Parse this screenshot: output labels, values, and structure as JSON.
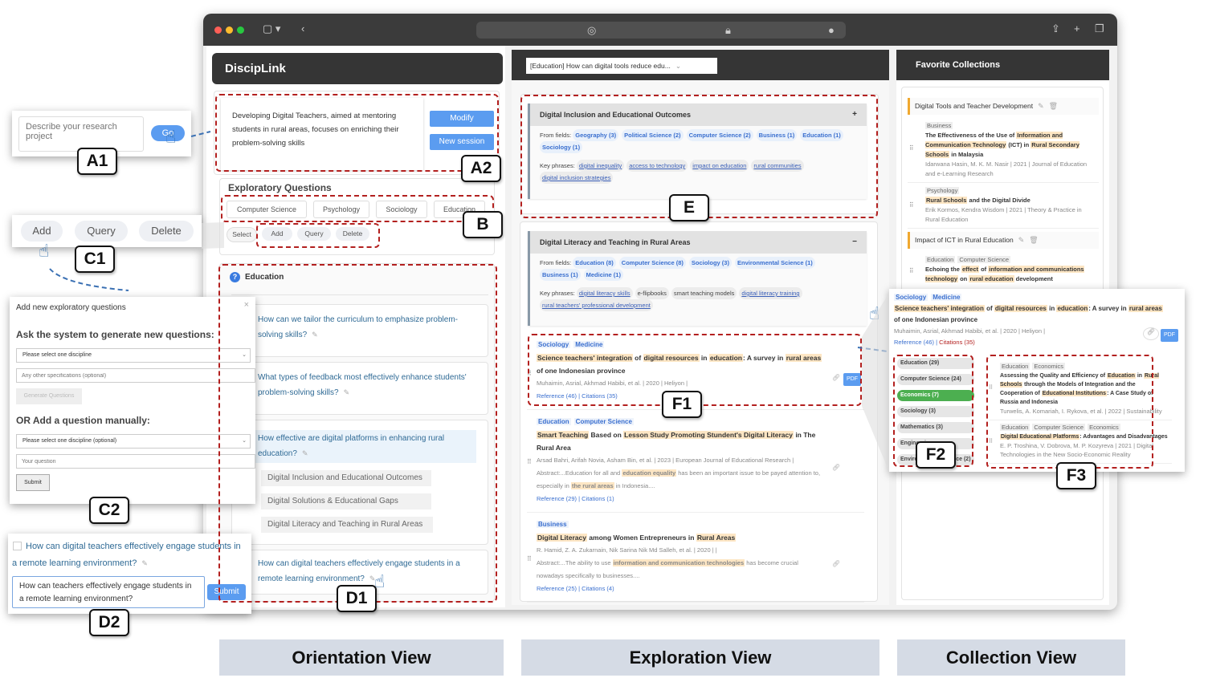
{
  "app": {
    "title": "DiscipLink"
  },
  "research": {
    "text": "Developing Digital Teachers, aimed at mentoring students in rural areas, focuses on enriching their problem-solving skills",
    "modify": "Modify",
    "new_session": "New session"
  },
  "a1": {
    "placeholder": "Describe your research project",
    "go": "Go"
  },
  "exploratory": {
    "title": "Exploratory Questions",
    "tabs": [
      "Computer Science",
      "Psychology",
      "Sociology",
      "Education"
    ],
    "actions": [
      "Select",
      "Add",
      "Query",
      "Delete"
    ]
  },
  "c1": {
    "actions": [
      "Add",
      "Query",
      "Delete"
    ]
  },
  "education": {
    "title": "Education",
    "questions": [
      "How can we tailor the curriculum to emphasize problem-solving skills?",
      "What types of feedback most effectively enhance students' problem-solving skills?",
      "How effective are digital platforms in enhancing rural education?",
      "How can digital teachers effectively engage students in a remote learning environment?"
    ],
    "subqueries": [
      "Digital Inclusion and Educational Outcomes",
      "Digital Solutions & Educational Gaps",
      "Digital Literacy and Teaching in Rural Areas"
    ]
  },
  "c2": {
    "title": "Add new exploratory questions",
    "gen_heading": "Ask the system to generate new questions:",
    "select1": "Please select one discipline",
    "spec_placeholder": "Any other specifications (optional)",
    "generate": "Generate Questions",
    "manual_heading": "OR Add a question manually:",
    "select2": "Please select one discipline (optional)",
    "question_placeholder": "Your question",
    "submit": "Submit"
  },
  "d2": {
    "question": "How can digital teachers effectively engage students in a remote learning environment?",
    "edit_value": "How can teachers effectively engage students in a remote learning environment?",
    "submit": "Submit"
  },
  "exploration": {
    "query_select": "[Education] How can digital tools reduce edu...",
    "clusters": [
      {
        "title": "Digital Inclusion and Educational Outcomes",
        "toggle": "+",
        "fields_label": "From fields:",
        "fields": [
          "Geography (3)",
          "Political Science (2)",
          "Computer Science (2)",
          "Business (1)",
          "Education (1)",
          "Sociology (1)"
        ],
        "phrases_label": "Key phrases:",
        "phrases": [
          "digital inequality",
          "access to technology",
          "impact on education",
          "rural communities",
          "digital inclusion strategies"
        ]
      },
      {
        "title": "Digital Literacy and Teaching in Rural Areas",
        "toggle": "−",
        "fields_label": "From fields:",
        "fields": [
          "Education (8)",
          "Computer Science (8)",
          "Sociology (3)",
          "Environmental Science (1)",
          "Business (1)",
          "Medicine (1)"
        ],
        "phrases_label": "Key phrases:",
        "phrases": [
          "digital literacy skills",
          "e-flipbooks",
          "smart teaching models",
          "digital literacy training",
          "rural teachers' professional development"
        ]
      }
    ],
    "papers": [
      {
        "disciplines": [
          "Sociology",
          "Medicine"
        ],
        "title": [
          [
            "Science teachers' integration",
            1
          ],
          [
            " of ",
            0
          ],
          [
            "digital resources",
            1
          ],
          [
            " in ",
            0
          ],
          [
            "education",
            1
          ],
          [
            ": A survey in ",
            0
          ],
          [
            "rural areas",
            1
          ],
          [
            " of one Indonesian province",
            0
          ]
        ],
        "meta": "Muhaimin, Asrial, Akhmad Habibi, et al.  |  2020  |  Heliyon  |",
        "abstract": null,
        "refs": "Reference (46)",
        "cites": "Citations (35)",
        "pdf": "PDF"
      },
      {
        "disciplines": [
          "Education",
          "Computer Science"
        ],
        "title": [
          [
            "Smart Teaching",
            1
          ],
          [
            " Based on ",
            0
          ],
          [
            "Lesson Study Promoting Stundent's Digital Literacy",
            1
          ],
          [
            " in The Rural Area",
            0
          ]
        ],
        "meta": "Arsad Bahri, Arifah Novia, Asham Bin, et al.  |  2023  |  European Journal of Educational Research  |",
        "abstract": [
          [
            "Abstract:...Education for all and ",
            0
          ],
          [
            "education equality",
            1
          ],
          [
            " has been an important issue to be payed attention to, especially in ",
            0
          ],
          [
            "the rural areas",
            1
          ],
          [
            " in Indonesia....",
            0
          ]
        ],
        "refs": "Reference (29)",
        "cites": "Citations (1)"
      },
      {
        "disciplines": [
          "Business"
        ],
        "title": [
          [
            "Digital Literacy",
            1
          ],
          [
            " among Women Entrepreneurs in ",
            0
          ],
          [
            "Rural Areas",
            1
          ]
        ],
        "meta": "R. Hamid, Z. A. Zukarnain, Nik Sarina Nik Md Salleh, et al.  |  2020  |    |",
        "abstract": [
          [
            "Abstract:...The ability to use ",
            0
          ],
          [
            "information and communication technologies",
            1
          ],
          [
            " has become crucial nowadays specifically to businesses....",
            0
          ]
        ],
        "refs": "Reference (25)",
        "cites": "Citations (4)"
      }
    ]
  },
  "collection": {
    "title": "Favorite Collections",
    "groups": [
      {
        "name": "Digital Tools and Teacher Development",
        "papers": [
          {
            "tags": [
              "Business"
            ],
            "title": [
              [
                "The Effectiveness of the Use of ",
                0
              ],
              [
                "Information and Communication Technology",
                1
              ],
              [
                " (ICT) in ",
                0
              ],
              [
                "Rural Secondary Schools",
                1
              ],
              [
                " in Malaysia",
                0
              ]
            ],
            "meta": "Idarwana Hasin, M. K. M. Nasir  |  2021  |  Journal of Education and e-Learning Research"
          },
          {
            "tags": [
              "Psychology"
            ],
            "title": [
              [
                "Rural Schools",
                1
              ],
              [
                " and the Digital Divide",
                0
              ]
            ],
            "meta": "Erik Kormos, Kendra Wisdom  |  2021  |  Theory & Practice in Rural Education"
          }
        ]
      },
      {
        "name": "Impact of ICT in Rural Education",
        "papers": [
          {
            "tags": [
              "Education",
              "Computer Science"
            ],
            "title": [
              [
                "Echoing the ",
                0
              ],
              [
                "effect",
                1
              ],
              [
                " of ",
                0
              ],
              [
                "information and communications technology",
                1
              ],
              [
                " on ",
                0
              ],
              [
                "rural education",
                1
              ],
              [
                " development",
                0
              ]
            ],
            "meta": ""
          }
        ]
      }
    ]
  },
  "citation_popup": {
    "disciplines": [
      "Sociology",
      "Medicine"
    ],
    "title": [
      [
        "Science teachers' integration",
        1
      ],
      [
        " of ",
        0
      ],
      [
        "digital resources",
        1
      ],
      [
        " in ",
        0
      ],
      [
        "education",
        1
      ],
      [
        ": A survey in ",
        0
      ],
      [
        "rural areas",
        1
      ],
      [
        " of one Indonesian province",
        0
      ]
    ],
    "meta": "Muhaimin, Asrial, Akhmad Habibi, et al.  |  2020  |  Heliyon  |",
    "refs": "Reference (46)",
    "cites": "Citations (35)",
    "pdf": "PDF",
    "filters": [
      "Education (29)",
      "Computer Science (24)",
      "Economics (7)",
      "Sociology (3)",
      "Mathematics (3)",
      "Engineering",
      "Environmental Science (2)"
    ],
    "active_filter": "Economics (7)",
    "active_color": "#4caf50",
    "papers": [
      {
        "tags": [
          "Education",
          "Economics"
        ],
        "title": [
          [
            "Assessing the Quality and Efficiency of ",
            0
          ],
          [
            "Education",
            1
          ],
          [
            " in ",
            0
          ],
          [
            "Rural Schools",
            1
          ],
          [
            " through the Models of Integration and the Cooperation of ",
            0
          ],
          [
            "Educational Institutions",
            1
          ],
          [
            ": A Case Study of Russia and Indonesia",
            0
          ]
        ],
        "meta": "Turwelis, A. Komariah, I. Rykova, et al.  |  2022  |  Sustainability"
      },
      {
        "tags": [
          "Education",
          "Computer Science",
          "Economics"
        ],
        "title": [
          [
            "Digital Educational Platforms",
            1
          ],
          [
            ": Advantages and Disadvantages",
            0
          ]
        ],
        "meta": "E. P. Troshina, V. Dobrova, M. P. Kozyreva  |  2021  |  Digital Technologies in the New Socio-Economic Reality"
      }
    ]
  },
  "labels": {
    "a1": "A1",
    "a2": "A2",
    "b": "B",
    "c1": "C1",
    "c2": "C2",
    "d1": "D1",
    "d2": "D2",
    "e": "E",
    "f1": "F1",
    "f2": "F2",
    "f3": "F3"
  },
  "views": [
    "Orientation View",
    "Exploration View",
    "Collection View"
  ],
  "colors": {
    "accent": "#5b9cf0",
    "annotation": "#b3201f",
    "highlight": "#fde6c4",
    "header": "#353535"
  }
}
